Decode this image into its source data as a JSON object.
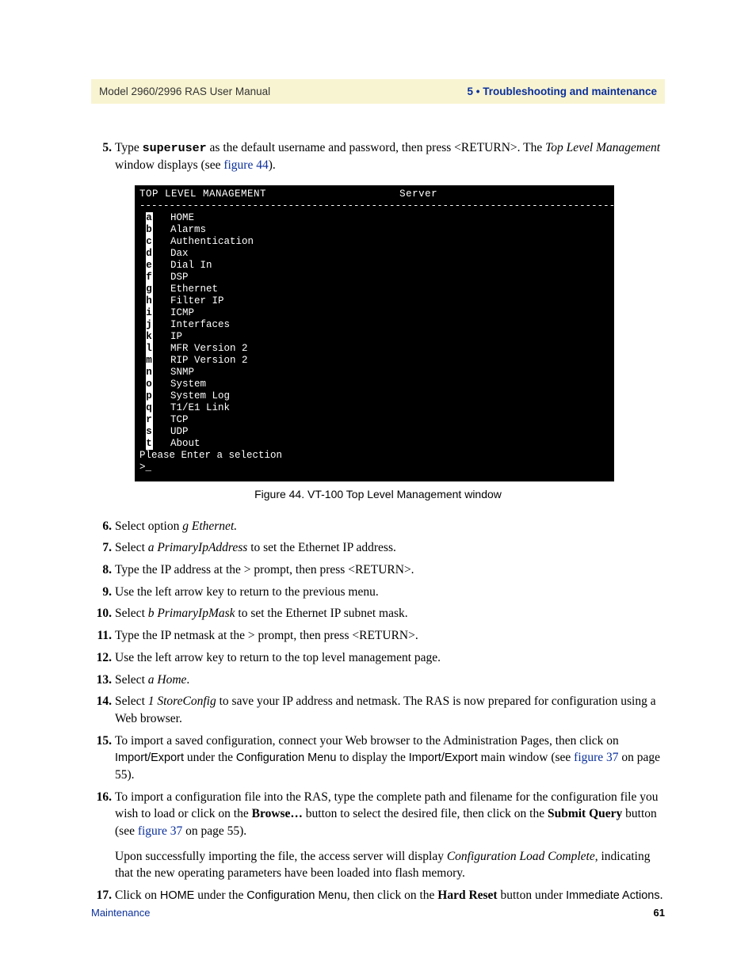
{
  "header": {
    "left": "Model 2960/2996 RAS User Manual",
    "right": "5 • Troubleshooting and maintenance"
  },
  "terminal": {
    "title_left": "TOP LEVEL MANAGEMENT",
    "title_right": "Server",
    "menu": [
      {
        "key": "a",
        "label": "HOME"
      },
      {
        "key": "b",
        "label": "Alarms"
      },
      {
        "key": "c",
        "label": "Authentication"
      },
      {
        "key": "d",
        "label": "Dax"
      },
      {
        "key": "e",
        "label": "Dial In"
      },
      {
        "key": "f",
        "label": "DSP"
      },
      {
        "key": "g",
        "label": "Ethernet"
      },
      {
        "key": "h",
        "label": "Filter IP"
      },
      {
        "key": "i",
        "label": "ICMP"
      },
      {
        "key": "j",
        "label": "Interfaces"
      },
      {
        "key": "k",
        "label": "IP"
      },
      {
        "key": "l",
        "label": "MFR Version 2"
      },
      {
        "key": "m",
        "label": "RIP Version 2"
      },
      {
        "key": "n",
        "label": "SNMP"
      },
      {
        "key": "o",
        "label": "System"
      },
      {
        "key": "p",
        "label": "System Log"
      },
      {
        "key": "q",
        "label": "T1/E1 Link"
      },
      {
        "key": "r",
        "label": "TCP"
      },
      {
        "key": "s",
        "label": "UDP"
      },
      {
        "key": "t",
        "label": "About"
      }
    ],
    "prompt1": "Please Enter a selection",
    "prompt2": ">_"
  },
  "caption": "Figure 44. VT-100 Top Level Management window",
  "steps": {
    "s5_a": "Type ",
    "s5_mono": "superuser",
    "s5_b": " as the default username and password, then press <RETURN>. The ",
    "s5_ital": "Top Level Management",
    "s5_c": " window displays (see ",
    "s5_link": "figure 44",
    "s5_d": ").",
    "s6_a": "Select option ",
    "s6_ital": "g Ethernet.",
    "s7_a": "Select ",
    "s7_ital": "a PrimaryIpAddress",
    "s7_b": " to set the Ethernet IP address.",
    "s8": "Type the IP address at the > prompt, then press <RETURN>.",
    "s9": "Use the left arrow key to return to the previous menu.",
    "s10_a": "Select ",
    "s10_ital": "b PrimaryIpMask",
    "s10_b": " to set the Ethernet IP subnet mask.",
    "s11": "Type the IP netmask at the > prompt, then press <RETURN>.",
    "s12": "Use the left arrow key to return to the top level management page.",
    "s13_a": "Select ",
    "s13_ital": "a Home",
    "s13_b": ".",
    "s14_a": "Select ",
    "s14_ital": "1 StoreConfig",
    "s14_b": " to save your IP address and netmask. The RAS is now prepared for configuration using a Web browser.",
    "s15_a": "To import a saved configuration, connect your Web browser to the Administration Pages, then click on ",
    "s15_sans1": "Import/Export",
    "s15_b": " under the ",
    "s15_sans2": "Configuration Menu",
    "s15_c": " to display the ",
    "s15_sans3": "Import/Export",
    "s15_d": " main window (see ",
    "s15_link": "figure 37",
    "s15_e": " on page 55).",
    "s16_a": "To import a configuration file into the RAS, type the complete path and filename for the configuration file you wish to load or click on the ",
    "s16_bold1": "Browse…",
    "s16_b": " button to select the desired file, then click on the ",
    "s16_bold2": "Submit Query",
    "s16_c": " button (see ",
    "s16_link": "figure 37",
    "s16_d": " on page 55).",
    "s16p2_a": "Upon successfully importing the file, the access server will display ",
    "s16p2_ital": "Configuration Load Complete",
    "s16p2_b": ", indicating that the new operating parameters have been loaded into flash memory.",
    "s17_a": "Click on ",
    "s17_sans1": "HOME",
    "s17_b": " under the ",
    "s17_sans2": "Configuration Menu",
    "s17_c": ", then click on the ",
    "s17_bold": "Hard Reset",
    "s17_d": " button under ",
    "s17_sans3": "Immediate Actions",
    "s17_e": "."
  },
  "nums": {
    "n5": "5.",
    "n6": "6.",
    "n7": "7.",
    "n8": "8.",
    "n9": "9.",
    "n10": "10.",
    "n11": "11.",
    "n12": "12.",
    "n13": "13.",
    "n14": "14.",
    "n15": "15.",
    "n16": "16.",
    "n17": "17."
  },
  "footer": {
    "left": "Maintenance",
    "right": "61"
  }
}
